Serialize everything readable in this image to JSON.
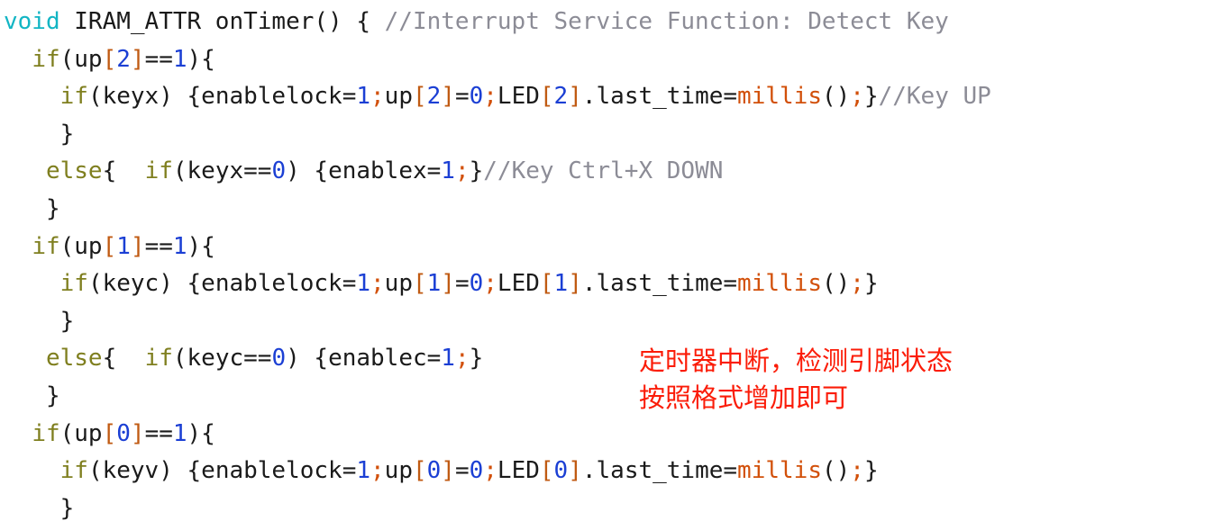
{
  "editor": {
    "background_color": "#ffffff",
    "language": "arduino-cpp",
    "font_size_px": 26
  },
  "colors": {
    "type_keyword": "#12b5c4",
    "control_keyword": "#7f7f1f",
    "comment": "#8c8c96",
    "function": "#d2500a",
    "number": "#1b3fd4",
    "bracket": "#c05a12",
    "semicolon": "#d2500a",
    "plain_text": "#1a1a1a",
    "annotation_red": "#fb1c08"
  },
  "code": {
    "lines": [
      {
        "indent": "",
        "tokens": [
          {
            "text": "void",
            "kind": "type"
          },
          {
            "text": " IRAM_ATTR onTimer() { ",
            "kind": "plain"
          },
          {
            "text": "//Interrupt Service Function: Detect Key",
            "kind": "comment"
          }
        ]
      },
      {
        "indent": "  ",
        "tokens": [
          {
            "text": "if",
            "kind": "kw"
          },
          {
            "text": "(up",
            "kind": "plain"
          },
          {
            "text": "[",
            "kind": "brk"
          },
          {
            "text": "2",
            "kind": "num"
          },
          {
            "text": "]",
            "kind": "brk"
          },
          {
            "text": "==",
            "kind": "op"
          },
          {
            "text": "1",
            "kind": "num"
          },
          {
            "text": "){",
            "kind": "plain"
          }
        ]
      },
      {
        "indent": "    ",
        "tokens": [
          {
            "text": "if",
            "kind": "kw"
          },
          {
            "text": "(keyx) {enablelock=",
            "kind": "plain"
          },
          {
            "text": "1",
            "kind": "num"
          },
          {
            "text": ";",
            "kind": "semi"
          },
          {
            "text": "up",
            "kind": "plain"
          },
          {
            "text": "[",
            "kind": "brk"
          },
          {
            "text": "2",
            "kind": "num"
          },
          {
            "text": "]",
            "kind": "brk"
          },
          {
            "text": "=",
            "kind": "op"
          },
          {
            "text": "0",
            "kind": "num"
          },
          {
            "text": ";",
            "kind": "semi"
          },
          {
            "text": "LED",
            "kind": "plain"
          },
          {
            "text": "[",
            "kind": "brk"
          },
          {
            "text": "2",
            "kind": "num"
          },
          {
            "text": "]",
            "kind": "brk"
          },
          {
            "text": ".last_time=",
            "kind": "plain"
          },
          {
            "text": "millis",
            "kind": "fn"
          },
          {
            "text": "()",
            "kind": "plain"
          },
          {
            "text": ";",
            "kind": "semi"
          },
          {
            "text": "}",
            "kind": "plain"
          },
          {
            "text": "//Key UP",
            "kind": "comment"
          }
        ]
      },
      {
        "indent": "    ",
        "tokens": [
          {
            "text": "}",
            "kind": "plain"
          }
        ]
      },
      {
        "indent": "   ",
        "tokens": [
          {
            "text": "else",
            "kind": "kw"
          },
          {
            "text": "{  ",
            "kind": "plain"
          },
          {
            "text": "if",
            "kind": "kw"
          },
          {
            "text": "(keyx==",
            "kind": "plain"
          },
          {
            "text": "0",
            "kind": "num"
          },
          {
            "text": ") {enablex=",
            "kind": "plain"
          },
          {
            "text": "1",
            "kind": "num"
          },
          {
            "text": ";",
            "kind": "semi"
          },
          {
            "text": "}",
            "kind": "plain"
          },
          {
            "text": "//Key Ctrl+X DOWN",
            "kind": "comment"
          }
        ]
      },
      {
        "indent": "   ",
        "tokens": [
          {
            "text": "}",
            "kind": "plain"
          }
        ]
      },
      {
        "indent": "  ",
        "tokens": [
          {
            "text": "if",
            "kind": "kw"
          },
          {
            "text": "(up",
            "kind": "plain"
          },
          {
            "text": "[",
            "kind": "brk"
          },
          {
            "text": "1",
            "kind": "num"
          },
          {
            "text": "]",
            "kind": "brk"
          },
          {
            "text": "==",
            "kind": "op"
          },
          {
            "text": "1",
            "kind": "num"
          },
          {
            "text": "){",
            "kind": "plain"
          }
        ]
      },
      {
        "indent": "    ",
        "tokens": [
          {
            "text": "if",
            "kind": "kw"
          },
          {
            "text": "(keyc) {enablelock=",
            "kind": "plain"
          },
          {
            "text": "1",
            "kind": "num"
          },
          {
            "text": ";",
            "kind": "semi"
          },
          {
            "text": "up",
            "kind": "plain"
          },
          {
            "text": "[",
            "kind": "brk"
          },
          {
            "text": "1",
            "kind": "num"
          },
          {
            "text": "]",
            "kind": "brk"
          },
          {
            "text": "=",
            "kind": "op"
          },
          {
            "text": "0",
            "kind": "num"
          },
          {
            "text": ";",
            "kind": "semi"
          },
          {
            "text": "LED",
            "kind": "plain"
          },
          {
            "text": "[",
            "kind": "brk"
          },
          {
            "text": "1",
            "kind": "num"
          },
          {
            "text": "]",
            "kind": "brk"
          },
          {
            "text": ".last_time=",
            "kind": "plain"
          },
          {
            "text": "millis",
            "kind": "fn"
          },
          {
            "text": "()",
            "kind": "plain"
          },
          {
            "text": ";",
            "kind": "semi"
          },
          {
            "text": "}",
            "kind": "plain"
          }
        ]
      },
      {
        "indent": "    ",
        "tokens": [
          {
            "text": "}",
            "kind": "plain"
          }
        ]
      },
      {
        "indent": "   ",
        "tokens": [
          {
            "text": "else",
            "kind": "kw"
          },
          {
            "text": "{  ",
            "kind": "plain"
          },
          {
            "text": "if",
            "kind": "kw"
          },
          {
            "text": "(keyc==",
            "kind": "plain"
          },
          {
            "text": "0",
            "kind": "num"
          },
          {
            "text": ") {enablec=",
            "kind": "plain"
          },
          {
            "text": "1",
            "kind": "num"
          },
          {
            "text": ";",
            "kind": "semi"
          },
          {
            "text": "}",
            "kind": "plain"
          }
        ]
      },
      {
        "indent": "   ",
        "tokens": [
          {
            "text": "}",
            "kind": "plain"
          }
        ]
      },
      {
        "indent": "  ",
        "tokens": [
          {
            "text": "if",
            "kind": "kw"
          },
          {
            "text": "(up",
            "kind": "plain"
          },
          {
            "text": "[",
            "kind": "brk"
          },
          {
            "text": "0",
            "kind": "num"
          },
          {
            "text": "]",
            "kind": "brk"
          },
          {
            "text": "==",
            "kind": "op"
          },
          {
            "text": "1",
            "kind": "num"
          },
          {
            "text": "){",
            "kind": "plain"
          }
        ]
      },
      {
        "indent": "    ",
        "tokens": [
          {
            "text": "if",
            "kind": "kw"
          },
          {
            "text": "(keyv) {enablelock=",
            "kind": "plain"
          },
          {
            "text": "1",
            "kind": "num"
          },
          {
            "text": ";",
            "kind": "semi"
          },
          {
            "text": "up",
            "kind": "plain"
          },
          {
            "text": "[",
            "kind": "brk"
          },
          {
            "text": "0",
            "kind": "num"
          },
          {
            "text": "]",
            "kind": "brk"
          },
          {
            "text": "=",
            "kind": "op"
          },
          {
            "text": "0",
            "kind": "num"
          },
          {
            "text": ";",
            "kind": "semi"
          },
          {
            "text": "LED",
            "kind": "plain"
          },
          {
            "text": "[",
            "kind": "brk"
          },
          {
            "text": "0",
            "kind": "num"
          },
          {
            "text": "]",
            "kind": "brk"
          },
          {
            "text": ".last_time=",
            "kind": "plain"
          },
          {
            "text": "millis",
            "kind": "fn"
          },
          {
            "text": "()",
            "kind": "plain"
          },
          {
            "text": ";",
            "kind": "semi"
          },
          {
            "text": "}",
            "kind": "plain"
          }
        ]
      },
      {
        "indent": "    ",
        "tokens": [
          {
            "text": "}",
            "kind": "plain"
          }
        ]
      }
    ]
  },
  "annotation": {
    "color": "#fb1c08",
    "lines": [
      "定时器中断，检测引脚状态",
      "按照格式增加即可"
    ]
  }
}
